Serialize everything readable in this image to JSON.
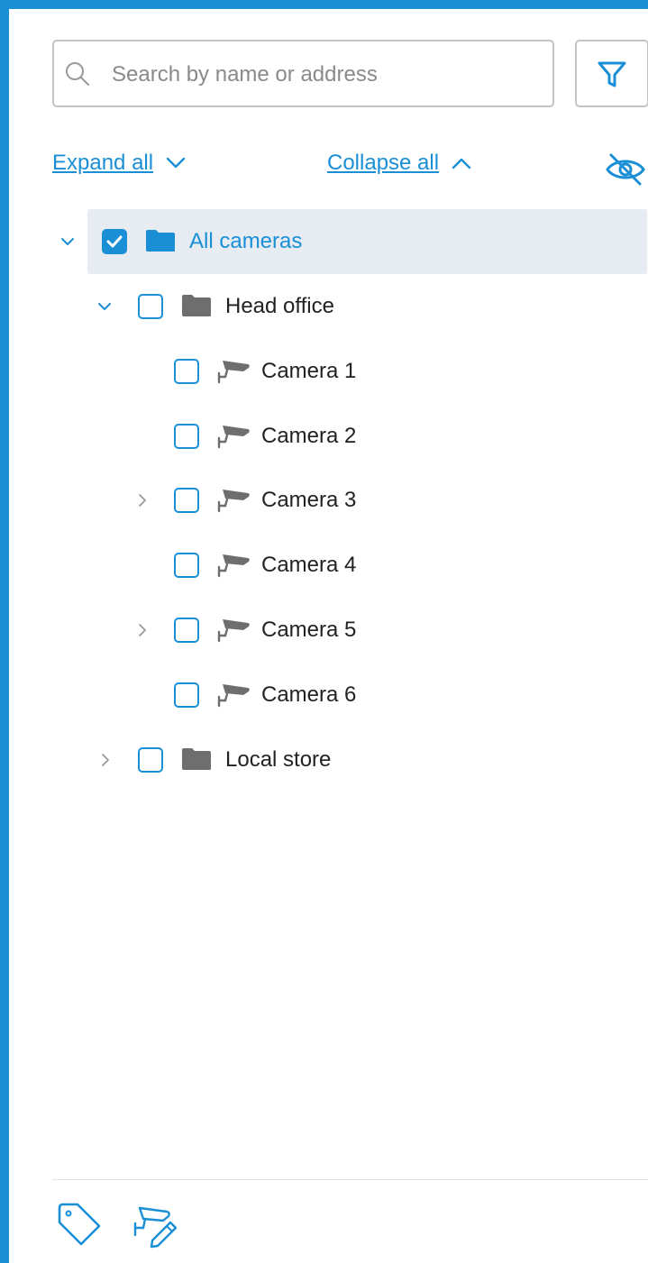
{
  "search": {
    "placeholder": "Search by name or address",
    "value": ""
  },
  "actions": {
    "expand_all": "Expand all",
    "collapse_all": "Collapse all"
  },
  "tree": {
    "root": {
      "label": "All cameras",
      "checked": true,
      "expanded": true
    },
    "groups": [
      {
        "label": "Head office",
        "checked": false,
        "expanded": true,
        "cameras": [
          {
            "label": "Camera 1",
            "checked": false,
            "has_children": false
          },
          {
            "label": "Camera 2",
            "checked": false,
            "has_children": false
          },
          {
            "label": "Camera 3",
            "checked": false,
            "has_children": true
          },
          {
            "label": "Camera 4",
            "checked": false,
            "has_children": false
          },
          {
            "label": "Camera 5",
            "checked": false,
            "has_children": true
          },
          {
            "label": "Camera 6",
            "checked": false,
            "has_children": false
          }
        ]
      },
      {
        "label": "Local store",
        "checked": false,
        "expanded": false
      }
    ]
  },
  "icons": {
    "search": "search-icon",
    "filter": "filter-icon",
    "hide": "eye-off-icon",
    "folder": "folder-icon",
    "camera": "camera-icon",
    "tag": "tag-icon",
    "edit_camera": "camera-edit-icon"
  },
  "colors": {
    "accent": "#1a8fd6",
    "selected_row": "#e6ecf2",
    "icon_gray": "#6e6e6e"
  }
}
